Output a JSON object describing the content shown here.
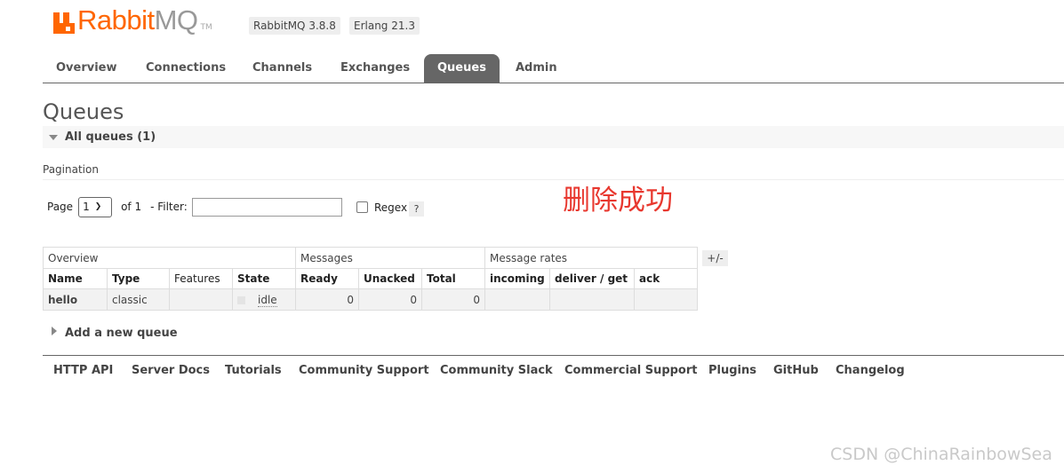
{
  "header": {
    "logo_rabbit": "Rabbit",
    "logo_mq": "MQ",
    "logo_tm": "TM",
    "rabbitmq_version": "RabbitMQ 3.8.8",
    "erlang_version": "Erlang 21.3",
    "brand_color": "#ff6600"
  },
  "tabs": [
    {
      "label": "Overview",
      "active": false
    },
    {
      "label": "Connections",
      "active": false
    },
    {
      "label": "Channels",
      "active": false
    },
    {
      "label": "Exchanges",
      "active": false
    },
    {
      "label": "Queues",
      "active": true
    },
    {
      "label": "Admin",
      "active": false
    }
  ],
  "page": {
    "title": "Queues",
    "section_label": "All queues (1)",
    "pagination_label": "Pagination",
    "page_label": "Page",
    "page_value": "1",
    "of_label": "of 1",
    "filter_label": "- Filter:",
    "filter_value": "",
    "regex_label": "Regex",
    "regex_checked": false,
    "help_label": "?",
    "annotation": "删除成功",
    "plus_minus": "+/-",
    "add_queue_label": "Add a new queue"
  },
  "table": {
    "groups": [
      "Overview",
      "Messages",
      "Message rates"
    ],
    "columns": [
      "Name",
      "Type",
      "Features",
      "State",
      "Ready",
      "Unacked",
      "Total",
      "incoming",
      "deliver / get",
      "ack"
    ],
    "rows": [
      {
        "name": "hello",
        "type": "classic",
        "features": "",
        "state": "idle",
        "ready": "0",
        "unacked": "0",
        "total": "0",
        "incoming": "",
        "deliver_get": "",
        "ack": ""
      }
    ]
  },
  "footer": {
    "links": [
      "HTTP API",
      "Server Docs",
      "Tutorials",
      "Community Support",
      "Community Slack",
      "Commercial Support",
      "Plugins",
      "GitHub",
      "Changelog"
    ]
  },
  "watermark": "CSDN @ChinaRainbowSea"
}
